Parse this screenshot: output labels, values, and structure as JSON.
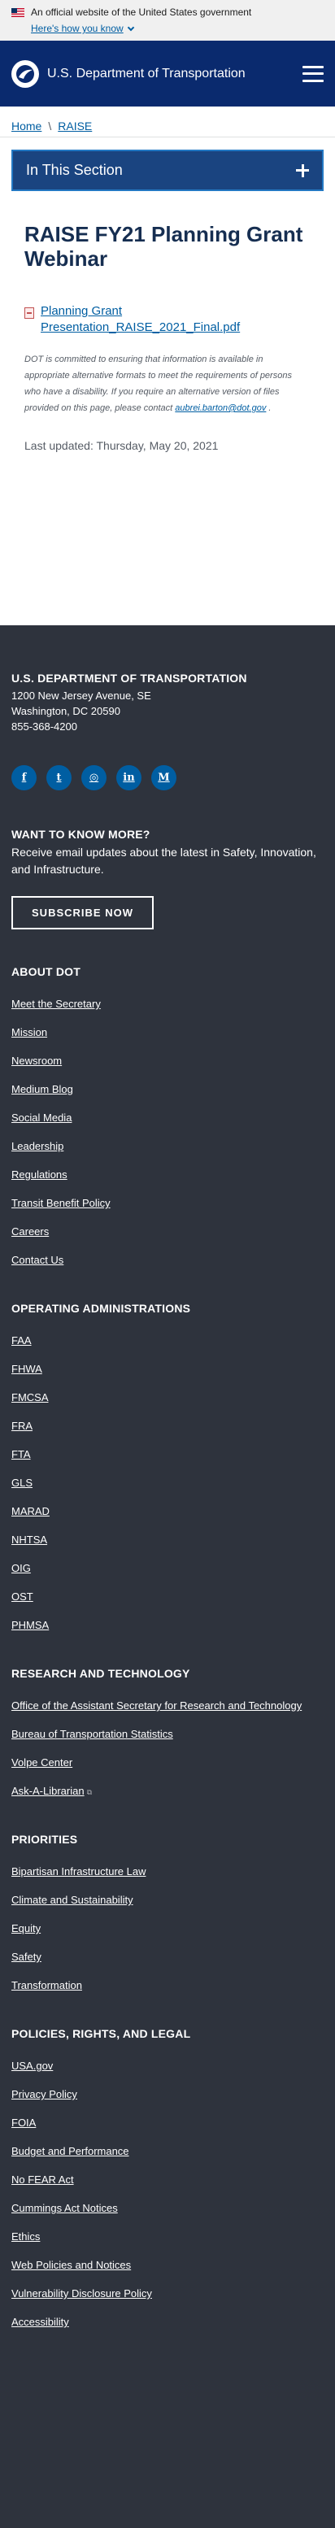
{
  "banner": {
    "text": "An official website of the United States government",
    "link": "Here's how you know"
  },
  "header": {
    "title": "U.S. Department of Transportation"
  },
  "breadcrumb": [
    "Home",
    "RAISE"
  ],
  "section_nav": {
    "label": "In This Section"
  },
  "page": {
    "title": "RAISE FY21 Planning Grant Webinar",
    "file_link": "Planning Grant Presentation_RAISE_2021_Final.pdf",
    "note_text": "DOT is committed to ensuring that information is available in appropriate alternative formats to meet the requirements of persons who have a disability. If you require an alternative version of files provided on this page, please contact ",
    "note_email": "aubrei.barton@dot.gov",
    "note_end": " .",
    "updated": "Last updated: Thursday, May 20, 2021"
  },
  "footer": {
    "org": "U.S. DEPARTMENT OF TRANSPORTATION",
    "address1": "1200 New Jersey Avenue, SE",
    "address2": "Washington, DC 20590",
    "phone": "855-368-4200",
    "social": [
      {
        "name": "facebook-icon",
        "glyph": "f"
      },
      {
        "name": "twitter-icon",
        "glyph": "t"
      },
      {
        "name": "instagram-icon",
        "glyph": "◎"
      },
      {
        "name": "linkedin-icon",
        "glyph": "in"
      },
      {
        "name": "medium-icon",
        "glyph": "M"
      }
    ],
    "want_title": "WANT TO KNOW MORE?",
    "want_text": "Receive email updates about the latest in Safety, Innovation, and Infrastructure.",
    "subscribe": "SUBSCRIBE NOW",
    "sections": [
      {
        "title": "ABOUT DOT",
        "items": [
          "Meet the Secretary",
          "Mission",
          "Newsroom",
          "Medium Blog",
          "Social Media",
          "Leadership",
          "Regulations",
          "Transit Benefit Policy",
          "Careers",
          "Contact Us"
        ]
      },
      {
        "title": "OPERATING ADMINISTRATIONS",
        "items": [
          "FAA",
          "FHWA",
          "FMCSA",
          "FRA",
          "FTA",
          "GLS",
          "MARAD",
          "NHTSA",
          "OIG",
          "OST",
          "PHMSA"
        ]
      },
      {
        "title": "RESEARCH AND TECHNOLOGY",
        "items": [
          "Office of the Assistant Secretary for Research and Technology",
          "Bureau of Transportation Statistics",
          "Volpe Center",
          "Ask-A-Librarian"
        ]
      },
      {
        "title": "PRIORITIES",
        "items": [
          "Bipartisan Infrastructure Law",
          "Climate and Sustainability",
          "Equity",
          "Safety",
          "Transformation"
        ]
      },
      {
        "title": "POLICIES, RIGHTS, AND LEGAL",
        "items": [
          "USA.gov",
          "Privacy Policy",
          "FOIA",
          "Budget and Performance",
          "No FEAR Act",
          "Cummings Act Notices",
          "Ethics",
          "Web Policies and Notices",
          "Vulnerability Disclosure Policy",
          "Accessibility"
        ]
      }
    ]
  }
}
